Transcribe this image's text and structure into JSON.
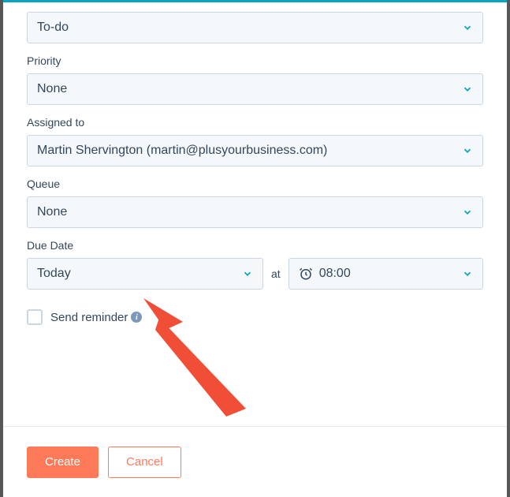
{
  "colors": {
    "accent": "#05a4bd",
    "primary_btn": "#ff7a59",
    "text": "#33475b",
    "border": "#cbd6e2",
    "select_bg": "#f5f8fa"
  },
  "type": {
    "value": "To-do"
  },
  "priority": {
    "label": "Priority",
    "value": "None"
  },
  "assigned_to": {
    "label": "Assigned to",
    "value": "Martin Shervington (martin@plusyourbusiness.com)"
  },
  "queue": {
    "label": "Queue",
    "value": "None"
  },
  "due_date": {
    "label": "Due Date",
    "date_value": "Today",
    "at_label": "at",
    "time_value": "08:00"
  },
  "reminder": {
    "label": "Send reminder",
    "checked": false
  },
  "footer": {
    "create_label": "Create",
    "cancel_label": "Cancel"
  }
}
